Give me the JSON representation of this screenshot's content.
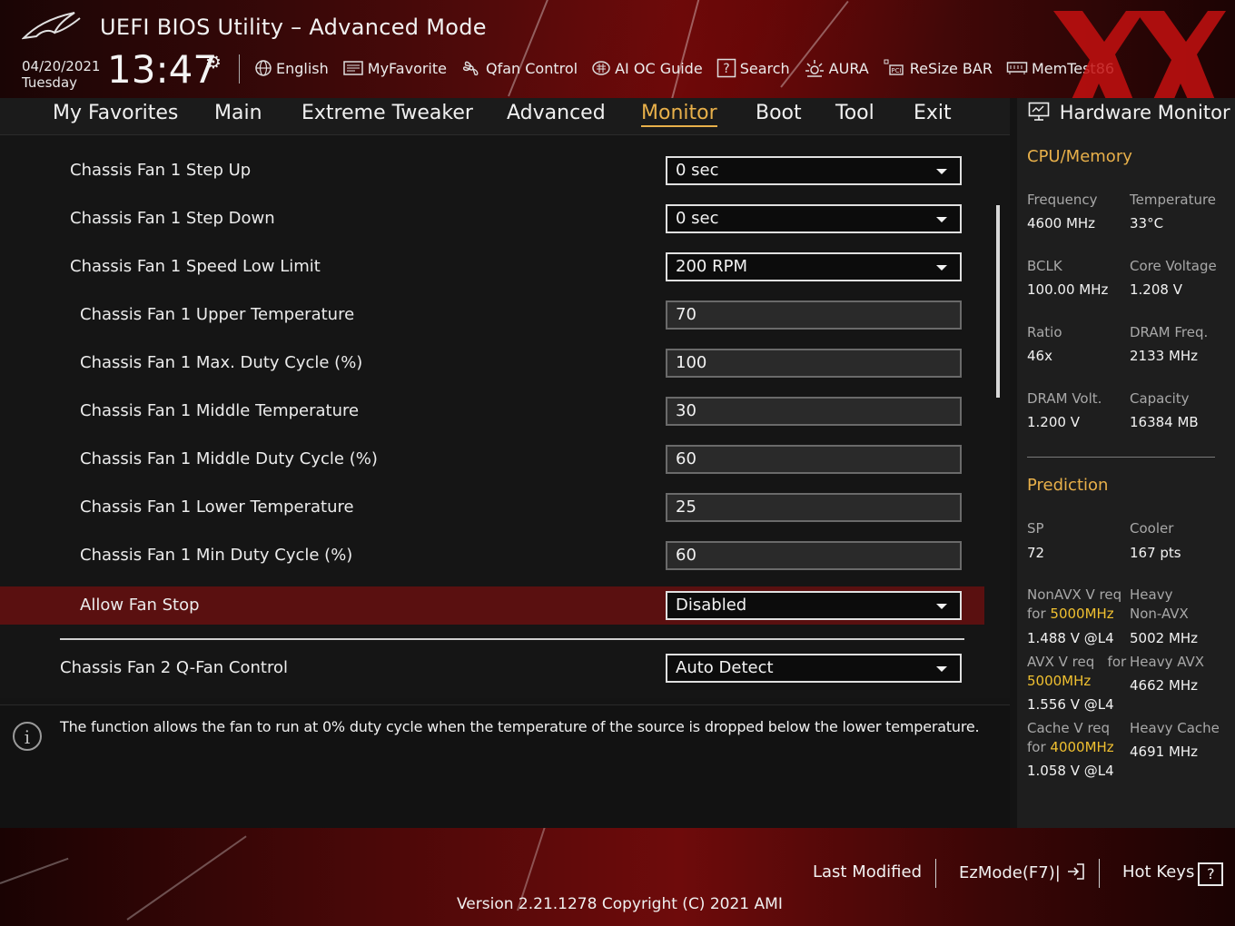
{
  "header": {
    "title": "UEFI BIOS Utility – Advanced Mode",
    "date": "04/20/2021",
    "day": "Tuesday",
    "time": "13:47",
    "toolbar": [
      {
        "label": "English",
        "icon": "globe-icon"
      },
      {
        "label": "MyFavorite",
        "icon": "favorite-icon"
      },
      {
        "label": "Qfan Control",
        "icon": "fan-icon"
      },
      {
        "label": "AI OC Guide",
        "icon": "ai-chip-icon"
      },
      {
        "label": "Search",
        "icon": "search-icon"
      },
      {
        "label": "AURA",
        "icon": "aura-icon"
      },
      {
        "label": "ReSize BAR",
        "icon": "resize-bar-icon"
      },
      {
        "label": "MemTest86",
        "icon": "memtest-icon"
      }
    ]
  },
  "nav": {
    "tabs": [
      "My Favorites",
      "Main",
      "Extreme Tweaker",
      "Advanced",
      "Monitor",
      "Boot",
      "Tool",
      "Exit"
    ],
    "active": "Monitor"
  },
  "settings": [
    {
      "label": "Chassis Fan 1 Step Up",
      "value": "0 sec",
      "kind": "dropdown"
    },
    {
      "label": "Chassis Fan 1 Step Down",
      "value": "0 sec",
      "kind": "dropdown"
    },
    {
      "label": "Chassis Fan 1 Speed Low Limit",
      "value": "200 RPM",
      "kind": "dropdown"
    },
    {
      "label": "Chassis Fan 1 Upper Temperature",
      "value": "70",
      "kind": "number"
    },
    {
      "label": "Chassis Fan 1 Max. Duty Cycle (%)",
      "value": "100",
      "kind": "number"
    },
    {
      "label": "Chassis Fan 1 Middle Temperature",
      "value": "30",
      "kind": "number"
    },
    {
      "label": "Chassis Fan 1 Middle Duty Cycle (%)",
      "value": "60",
      "kind": "number"
    },
    {
      "label": "Chassis Fan 1 Lower Temperature",
      "value": "25",
      "kind": "number"
    },
    {
      "label": "Chassis Fan 1 Min Duty Cycle (%)",
      "value": "60",
      "kind": "number"
    },
    {
      "label": "Allow Fan Stop",
      "value": "Disabled",
      "kind": "dropdown",
      "selected": true
    },
    {
      "label": "Chassis Fan 2 Q-Fan Control",
      "value": "Auto Detect",
      "kind": "dropdown"
    }
  ],
  "info": {
    "text": "The function allows the fan to run at 0% duty cycle when the temperature of the source is dropped below the lower temperature."
  },
  "hw_monitor": {
    "title": "Hardware Monitor",
    "cpu_memory": {
      "heading": "CPU/Memory",
      "frequency_label": "Frequency",
      "frequency": "4600 MHz",
      "temperature_label": "Temperature",
      "temperature": "33°C",
      "bclk_label": "BCLK",
      "bclk": "100.00 MHz",
      "core_voltage_label": "Core Voltage",
      "core_voltage": "1.208 V",
      "ratio_label": "Ratio",
      "ratio": "46x",
      "dram_freq_label": "DRAM Freq.",
      "dram_freq": "2133 MHz",
      "dram_volt_label": "DRAM Volt.",
      "dram_volt": "1.200 V",
      "capacity_label": "Capacity",
      "capacity": "16384 MB"
    },
    "prediction": {
      "heading": "Prediction",
      "sp_label": "SP",
      "sp": "72",
      "cooler_label": "Cooler",
      "cooler": "167 pts",
      "nonavx_label": "NonAVX V req",
      "for": "for",
      "nonavx_freq": "5000MHz",
      "nonavx_v": "1.488 V @L4",
      "heavy_nonavx_label1": "Heavy",
      "heavy_nonavx_label2": "Non-AVX",
      "heavy_nonavx": "5002 MHz",
      "avx_label": "AVX V req",
      "avx_for": "for",
      "avx_freq": "5000MHz",
      "avx_v": "1.556 V @L4",
      "heavy_avx_label": "Heavy AVX",
      "heavy_avx": "4662 MHz",
      "cache_label": "Cache V req",
      "cache_freq": "4000MHz",
      "cache_v": "1.058 V @L4",
      "heavy_cache_label": "Heavy Cache",
      "heavy_cache": "4691 MHz"
    }
  },
  "footer": {
    "last_modified": "Last Modified",
    "ezmode": "EzMode(F7)|",
    "hotkeys": "Hot Keys",
    "hotkeys_key": "?",
    "version": "Version 2.21.1278 Copyright (C) 2021 AMI"
  },
  "colors": {
    "accent": "#e8b04a",
    "highlight": "#f0c030",
    "selected_row": "#5a1010",
    "header_red": "#6a0c0c"
  }
}
